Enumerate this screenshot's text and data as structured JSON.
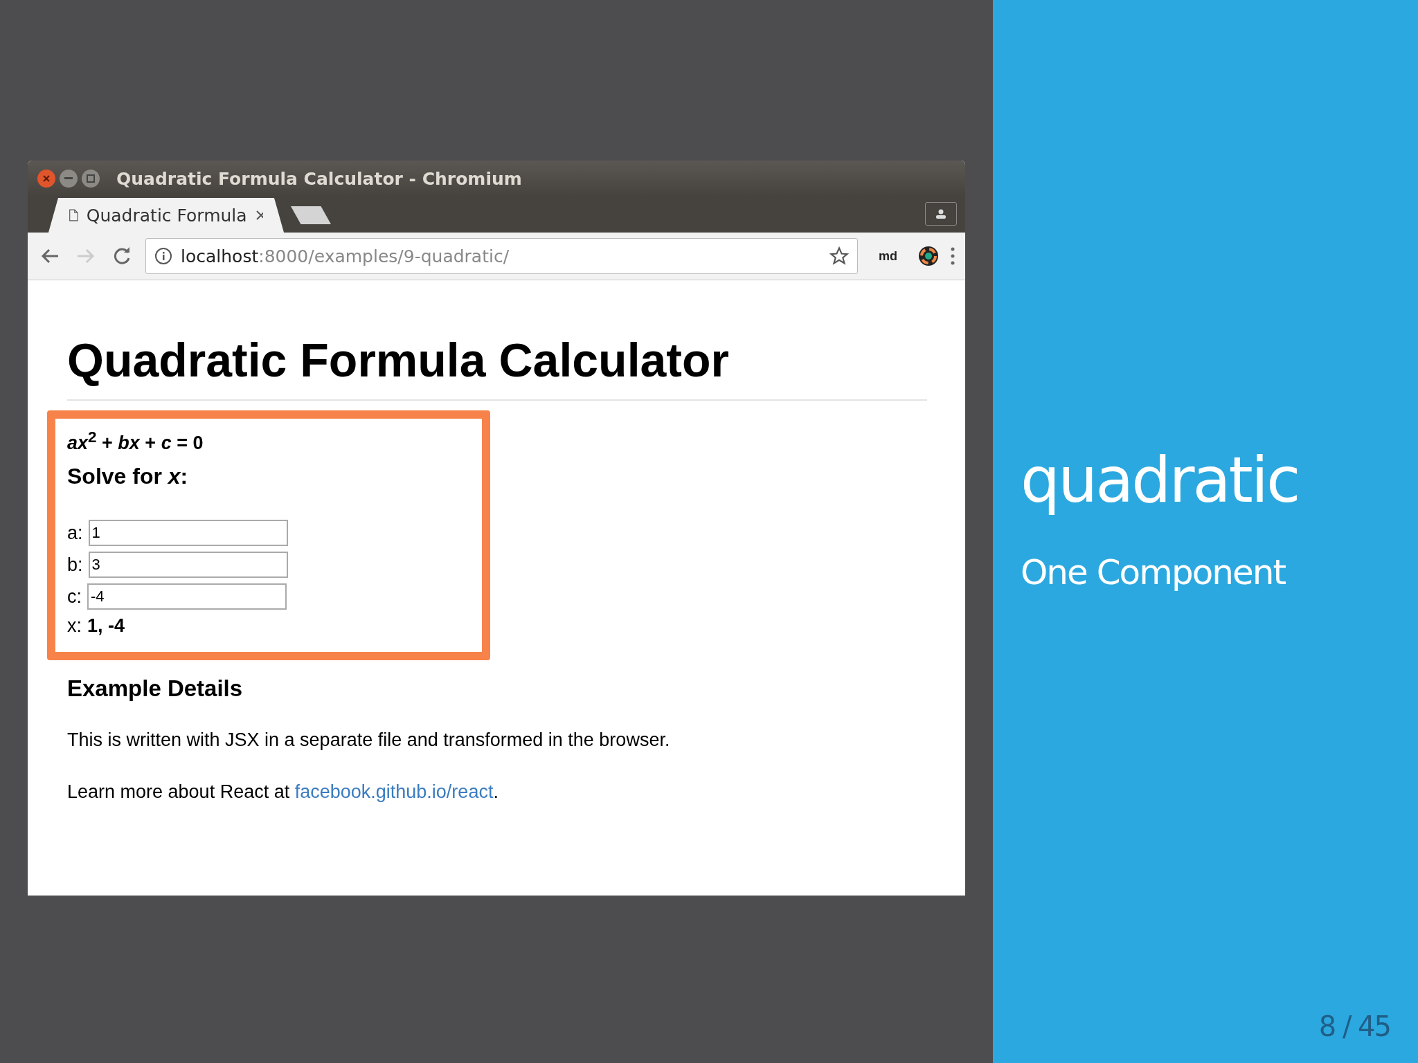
{
  "browser": {
    "title": "Quadratic Formula Calculator - Chromium",
    "tab": {
      "label": "Quadratic Formula",
      "selected": true
    },
    "url": {
      "host": "localhost",
      "rest": ":8000/examples/9-quadratic/"
    },
    "extension_label": "md"
  },
  "page": {
    "heading": "Quadratic Formula Calculator",
    "equation": "*ax*$^{2}$ + *bx* + *c* = 0",
    "solve_heading": "Solve for *x*:",
    "fields": [
      {
        "label": "a:",
        "value": "1"
      },
      {
        "label": "b:",
        "value": "3"
      },
      {
        "label": "c:",
        "value": "-4"
      }
    ],
    "result": {
      "label": "x:",
      "value": "1, -4"
    },
    "details_heading": "Example Details",
    "paragraph": "This is written with JSX in a separate file and transformed in the browser.",
    "link_paragraph": {
      "before": "Learn more about React at ",
      "link": "facebook.github.io/react",
      "after": "."
    }
  },
  "slide": {
    "title": "quadratic",
    "subtitle": "One Component",
    "counter": "8 / 45"
  }
}
